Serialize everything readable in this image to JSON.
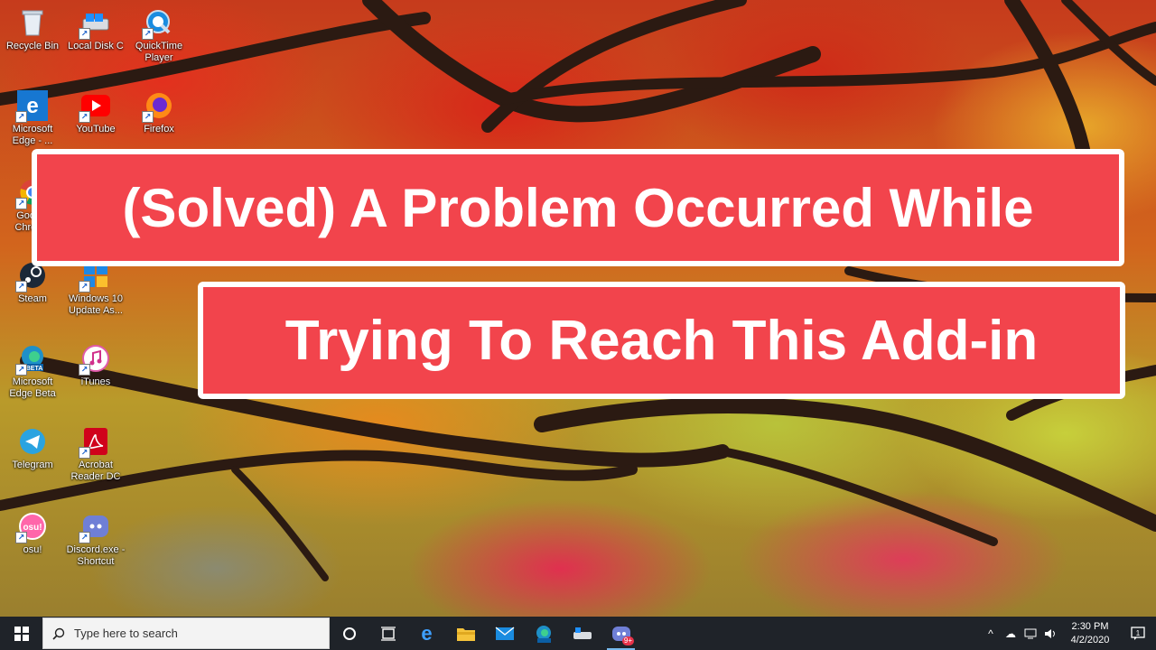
{
  "banner": {
    "line1": "(Solved) A Problem Occurred While",
    "line2": "Trying To Reach This Add-in"
  },
  "desktop_icons": [
    {
      "label": "Recycle Bin",
      "icon": "recycle-bin-icon"
    },
    {
      "label": "Local Disk C",
      "icon": "local-disk-icon"
    },
    {
      "label": "QuickTime Player",
      "icon": "quicktime-icon"
    },
    {
      "label": "Microsoft Edge - ...",
      "icon": "edge-icon"
    },
    {
      "label": "YouTube",
      "icon": "youtube-icon"
    },
    {
      "label": "Firefox",
      "icon": "firefox-icon"
    },
    {
      "label": "Google Chrome",
      "icon": "chrome-icon"
    },
    {
      "label": "Steam",
      "icon": "steam-icon"
    },
    {
      "label": "Windows 10 Update As...",
      "icon": "windows-update-icon"
    },
    {
      "label": "Microsoft Edge Beta",
      "icon": "edge-beta-icon"
    },
    {
      "label": "iTunes",
      "icon": "itunes-icon"
    },
    {
      "label": "Telegram",
      "icon": "telegram-icon"
    },
    {
      "label": "Acrobat Reader DC",
      "icon": "acrobat-icon"
    },
    {
      "label": "osu!",
      "icon": "osu-icon"
    },
    {
      "label": "Discord.exe - Shortcut",
      "icon": "discord-icon"
    }
  ],
  "taskbar": {
    "search_placeholder": "Type here to search",
    "pinned": [
      "cortana-icon",
      "task-view-icon",
      "edge-icon",
      "file-explorer-icon",
      "mail-icon",
      "edge-beta-icon",
      "local-disk-icon",
      "discord-icon"
    ],
    "discord_badge": "9+",
    "clock_time": "2:30 PM",
    "clock_date": "4/2/2020"
  },
  "colors": {
    "banner_fill": "#f2444c",
    "banner_border": "#ffffff",
    "taskbar": "#1f2329",
    "accent": "#76b9ed"
  }
}
